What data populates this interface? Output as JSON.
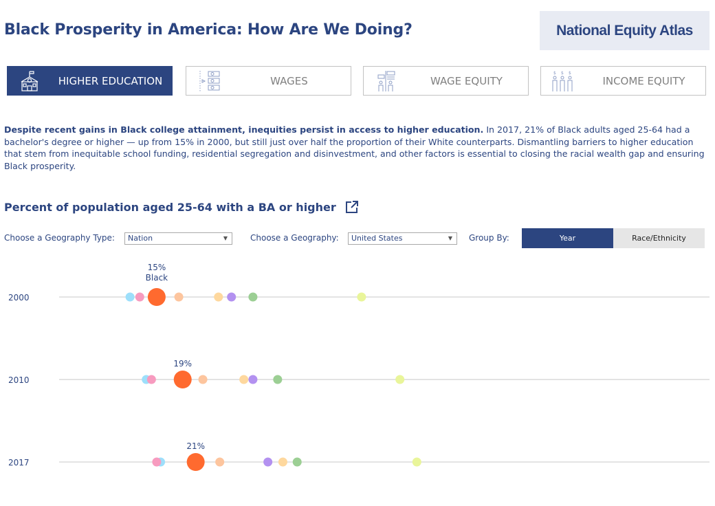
{
  "header": {
    "title": "Black Prosperity in America: How Are We Doing?",
    "logo_text": "National Equity Atlas"
  },
  "tabs": [
    {
      "label": "HIGHER EDUCATION",
      "icon": "school-icon",
      "active": true
    },
    {
      "label": "WAGES",
      "icon": "money-stack-icon",
      "active": false
    },
    {
      "label": "WAGE EQUITY",
      "icon": "wage-gap-people-icon",
      "active": false
    },
    {
      "label": "INCOME EQUITY",
      "icon": "income-people-icon",
      "active": false
    }
  ],
  "intro": {
    "bold": "Despite recent gains in Black college attainment, inequities persist in access to higher education.",
    "text": " In 2017, 21% of Black adults aged 25-64 had a bachelor's degree or higher — up from 15% in 2000, but still just over half the proportion of their White counterparts. Dismantling barriers to higher education that stem from inequitable school funding, residential segregation and disinvestment, and other factors is essential to closing the racial wealth gap and ensuring Black prosperity."
  },
  "controls": {
    "geo_type_label": "Choose a Geography Type:",
    "geo_type_value": "Nation",
    "geo_label": "Choose a Geography:",
    "geo_value": "United States",
    "group_by_label": "Group By:",
    "group_options": [
      {
        "label": "Year",
        "selected": true
      },
      {
        "label": "Race/Ethnicity",
        "selected": false
      }
    ]
  },
  "colors": {
    "primary": "#2c4580",
    "highlight": "#ff6a2f",
    "track": "#e3e3e3"
  },
  "chart_data": {
    "type": "scatter",
    "title": "Percent of population aged 25-64 with a BA or higher",
    "xlabel": "",
    "ylabel": "",
    "xlim": [
      0,
      100
    ],
    "grid": false,
    "categories": [
      "2000",
      "2010",
      "2017"
    ],
    "highlight_series": "Black",
    "series": [
      {
        "name": "series-light-blue",
        "color": "#9ddffb",
        "values": [
          10.9,
          13.4,
          15.6
        ]
      },
      {
        "name": "series-pink",
        "color": "#f79bbf",
        "values": [
          12.4,
          14.2,
          15.0
        ]
      },
      {
        "name": "Black",
        "color": "#ff6a2f",
        "values": [
          15,
          19,
          21
        ],
        "labels": [
          "15%",
          "19%",
          "21%"
        ],
        "highlight": true
      },
      {
        "name": "series-peach",
        "color": "#fdc59e",
        "values": [
          18.4,
          22.1,
          24.7
        ]
      },
      {
        "name": "series-light-orange",
        "color": "#fed89e",
        "values": [
          24.5,
          28.4,
          34.4
        ]
      },
      {
        "name": "series-purple",
        "color": "#b391f0",
        "values": [
          26.5,
          29.8,
          32.1
        ]
      },
      {
        "name": "series-green",
        "color": "#9ccf94",
        "values": [
          29.8,
          33.6,
          36.6
        ]
      },
      {
        "name": "series-lime",
        "color": "#e9f59a",
        "values": [
          46.5,
          52.4,
          55.0
        ]
      }
    ],
    "annotations": [
      {
        "category": "2000",
        "text": "15%",
        "subtext": "Black"
      },
      {
        "category": "2010",
        "text": "19%"
      },
      {
        "category": "2017",
        "text": "21%"
      }
    ]
  }
}
